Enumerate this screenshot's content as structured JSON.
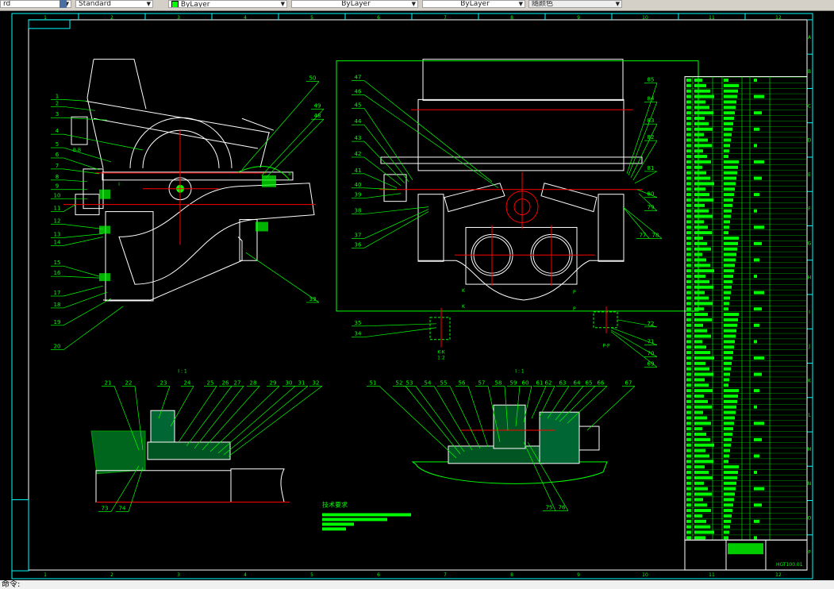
{
  "toolbar": {
    "text_style_partial": "rd",
    "dim_style": "Standard",
    "color": "ByLayer",
    "linetype": "ByLayer",
    "lineweight": "ByLayer",
    "plot_style": "随颜色",
    "color_swatch": "#00ff00"
  },
  "command_line": {
    "prompt": "命令:"
  },
  "frame": {
    "columns": [
      "1",
      "2",
      "3",
      "4",
      "5",
      "6",
      "7",
      "8",
      "9",
      "10",
      "11",
      "12"
    ],
    "rows": [
      "A",
      "B",
      "C",
      "D",
      "E",
      "F",
      "G",
      "H",
      "I",
      "J",
      "K",
      "L",
      "M",
      "N",
      "O",
      "P"
    ]
  },
  "colors": {
    "outline": "#ffffff",
    "leader": "#00ff00",
    "centerline": "#ff0000",
    "border": "#00ffff"
  },
  "labels": {
    "front_view": [
      "1",
      "2",
      "3",
      "4",
      "5",
      "6",
      "7",
      "8",
      "9",
      "10",
      "11",
      "12",
      "13",
      "14",
      "15",
      "16",
      "17",
      "18",
      "19",
      "20",
      "50",
      "49",
      "48",
      "33"
    ],
    "side_view": [
      "47",
      "46",
      "45",
      "44",
      "43",
      "42",
      "41",
      "40",
      "39",
      "38",
      "37",
      "36",
      "35",
      "34",
      "85",
      "84",
      "83",
      "82",
      "81",
      "80",
      "79",
      "77",
      "78",
      "72",
      "71",
      "70",
      "69"
    ],
    "detail_1": [
      "21",
      "22",
      "23",
      "24",
      "25",
      "26",
      "27",
      "28",
      "29",
      "30",
      "31",
      "32",
      "73",
      "74"
    ],
    "detail_2": [
      "51",
      "52",
      "53",
      "54",
      "55",
      "56",
      "57",
      "58",
      "59",
      "60",
      "61",
      "62",
      "63",
      "64",
      "65",
      "66",
      "67",
      "75",
      "76"
    ],
    "section_marks": {
      "b_b": "B-B",
      "k_k": "K-K",
      "p_p": "P-P",
      "scale": "1:2",
      "detail_1": "I",
      "detail_2": "II",
      "view_1": "I : 1",
      "k": "K",
      "p": "P"
    }
  },
  "notes": {
    "title": "技术要求"
  },
  "title_block": {
    "drawing_no": "HGT100.01"
  }
}
